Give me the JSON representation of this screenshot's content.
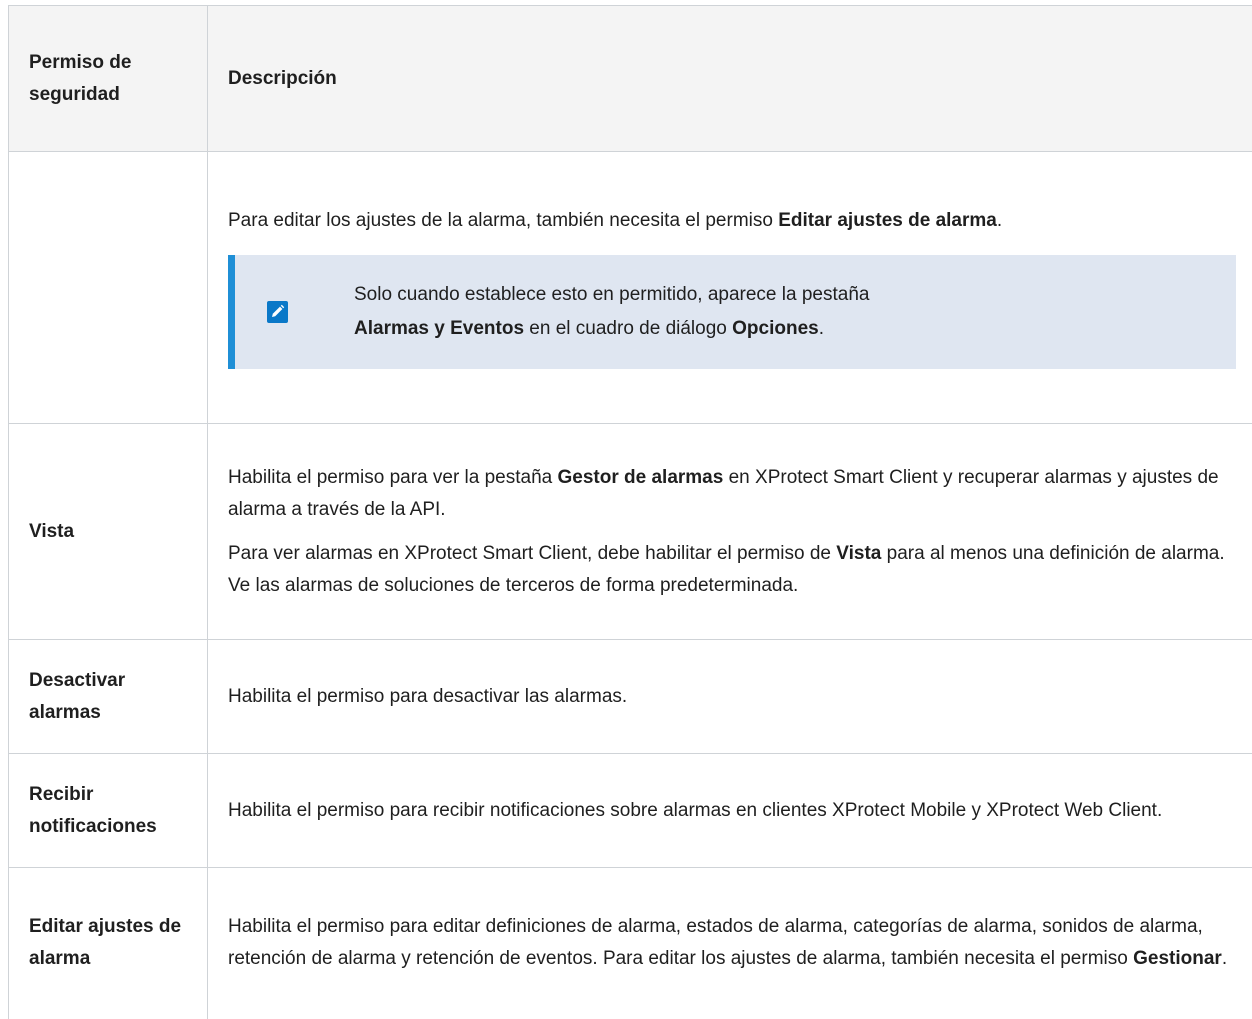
{
  "header": {
    "col1": "Permiso de seguridad",
    "col2": "Descripción"
  },
  "rows": [
    {
      "permission": "",
      "desc": {
        "p1_a": "Para editar los ajustes de la alarma, también necesita el permiso ",
        "p1_b": "Editar ajustes de alarma",
        "p1_c": "."
      },
      "note": {
        "icon": "pencil-note-icon",
        "a": "Solo cuando establece esto en permitido, aparece la pestaña",
        "b": "Alarmas y Eventos",
        "c": " en el cuadro de diálogo ",
        "d": "Opciones",
        "e": "."
      }
    },
    {
      "permission": "Vista",
      "desc": {
        "p1_a": "Habilita el permiso para ver la pestaña ",
        "p1_b": "Gestor de alarmas",
        "p1_c": " en XProtect Smart Client y recuperar alarmas y ajustes de alarma a través de la API.",
        "p2_a": "Para ver alarmas en XProtect Smart Client, debe habilitar el permiso de ",
        "p2_b": "Vista",
        "p2_c": " para al menos una definición de alarma. Ve las alarmas de soluciones de terceros de forma predeterminada."
      }
    },
    {
      "permission": "Desactivar alarmas",
      "desc": {
        "p1_a": "Habilita el permiso para desactivar las alarmas."
      }
    },
    {
      "permission": "Recibir notificaciones",
      "desc": {
        "p1_a": "Habilita el permiso para recibir notificaciones sobre alarmas en clientes XProtect Mobile y XProtect Web Client."
      }
    },
    {
      "permission": "Editar ajustes de alarma",
      "desc": {
        "p1_a": "Habilita el permiso para editar definiciones de alarma, estados de alarma, categorías de alarma, sonidos de alarma, retención de alarma y retención de eventos. Para editar los ajustes de alarma, también necesita el permiso ",
        "p1_b": "Gestionar",
        "p1_c": "."
      }
    }
  ],
  "colors": {
    "note_bg": "#dfe6f1",
    "note_bar": "#1f8fd6",
    "icon": "#0a78c8",
    "border": "#cfd3d7"
  }
}
